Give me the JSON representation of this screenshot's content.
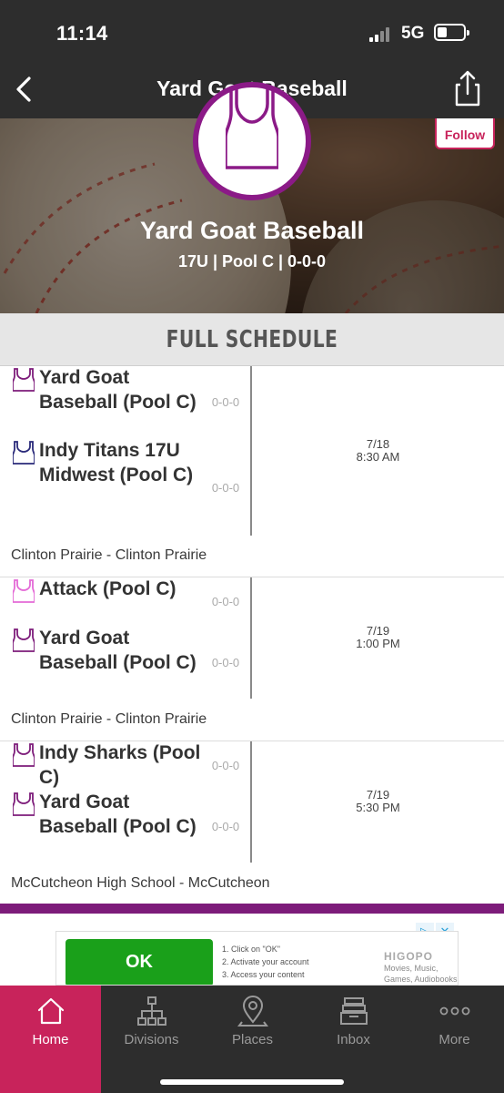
{
  "status_bar": {
    "time": "11:14",
    "network": "5G"
  },
  "nav": {
    "title": "Yard Goat Baseball"
  },
  "hero": {
    "team_name": "Yard Goat Baseball",
    "subtitle": "17U | Pool C | 0-0-0",
    "follow_label": "Follow"
  },
  "schedule": {
    "header": "FULL SCHEDULE",
    "games": [
      {
        "home": {
          "name": "Yard Goat Baseball (Pool C)",
          "record": "0-0-0",
          "color": "#7d1c7a"
        },
        "away": {
          "name": "Indy Titans 17U Midwest (Pool C)",
          "record": "0-0-0",
          "color": "#2a2a7a"
        },
        "date": "7/18",
        "time": "8:30 AM",
        "venue": "Clinton Prairie - Clinton Prairie"
      },
      {
        "home": {
          "name": "Attack (Pool C)",
          "record": "0-0-0",
          "color": "#e46ad6"
        },
        "away": {
          "name": "Yard Goat Baseball (Pool C)",
          "record": "0-0-0",
          "color": "#7d1c7a"
        },
        "date": "7/19",
        "time": "1:00 PM",
        "venue": "Clinton Prairie - Clinton Prairie"
      },
      {
        "home": {
          "name": "Indy Sharks (Pool C)",
          "record": "0-0-0",
          "color": "#7d1c7a"
        },
        "away": {
          "name": "Yard Goat Baseball (Pool C)",
          "record": "0-0-0",
          "color": "#7d1c7a"
        },
        "date": "7/19",
        "time": "5:30 PM",
        "venue": "McCutcheon High School - McCutcheon"
      }
    ]
  },
  "ad": {
    "button": "OK",
    "steps": [
      "1. Click on \"OK\"",
      "2. Activate your account",
      "3. Access your content"
    ],
    "brand": "HIGOPO",
    "description": "Movies, Music, Games, Audiobooks"
  },
  "tabs": [
    {
      "label": "Home",
      "icon": "home-icon",
      "active": true
    },
    {
      "label": "Divisions",
      "icon": "divisions-icon",
      "active": false
    },
    {
      "label": "Places",
      "icon": "places-icon",
      "active": false
    },
    {
      "label": "Inbox",
      "icon": "inbox-icon",
      "active": false
    },
    {
      "label": "More",
      "icon": "more-icon",
      "active": false
    }
  ],
  "colors": {
    "accent": "#c8235b",
    "brand_purple": "#7d1c7a",
    "bar": "#2d2d2d"
  }
}
